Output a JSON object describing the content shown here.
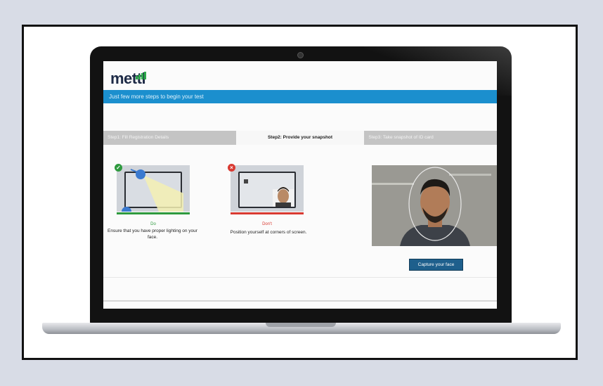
{
  "brand": {
    "logo_text": "mettl"
  },
  "banner": {
    "text": "Just few more steps to begin your test"
  },
  "steps": [
    {
      "label": "Step1: Fill Registration Details",
      "state": "done"
    },
    {
      "label": "Step2: Provide your snapshot",
      "state": "active"
    },
    {
      "label": "Step3: Take snapshot of ID card",
      "state": "pending"
    }
  ],
  "guides": {
    "do": {
      "badge": "✓",
      "title": "Do",
      "text": "Ensure that you have proper lighting on your face.",
      "color": "#2e9a3e"
    },
    "dont": {
      "badge": "×",
      "title": "Don't",
      "text": "Position yourself at corners of screen.",
      "color": "#d93a32"
    }
  },
  "capture": {
    "button_label": "Capture your face"
  },
  "colors": {
    "accent": "#1b8fce",
    "button": "#1e5f8c",
    "do": "#2e9a3e",
    "dont": "#d93a32"
  }
}
